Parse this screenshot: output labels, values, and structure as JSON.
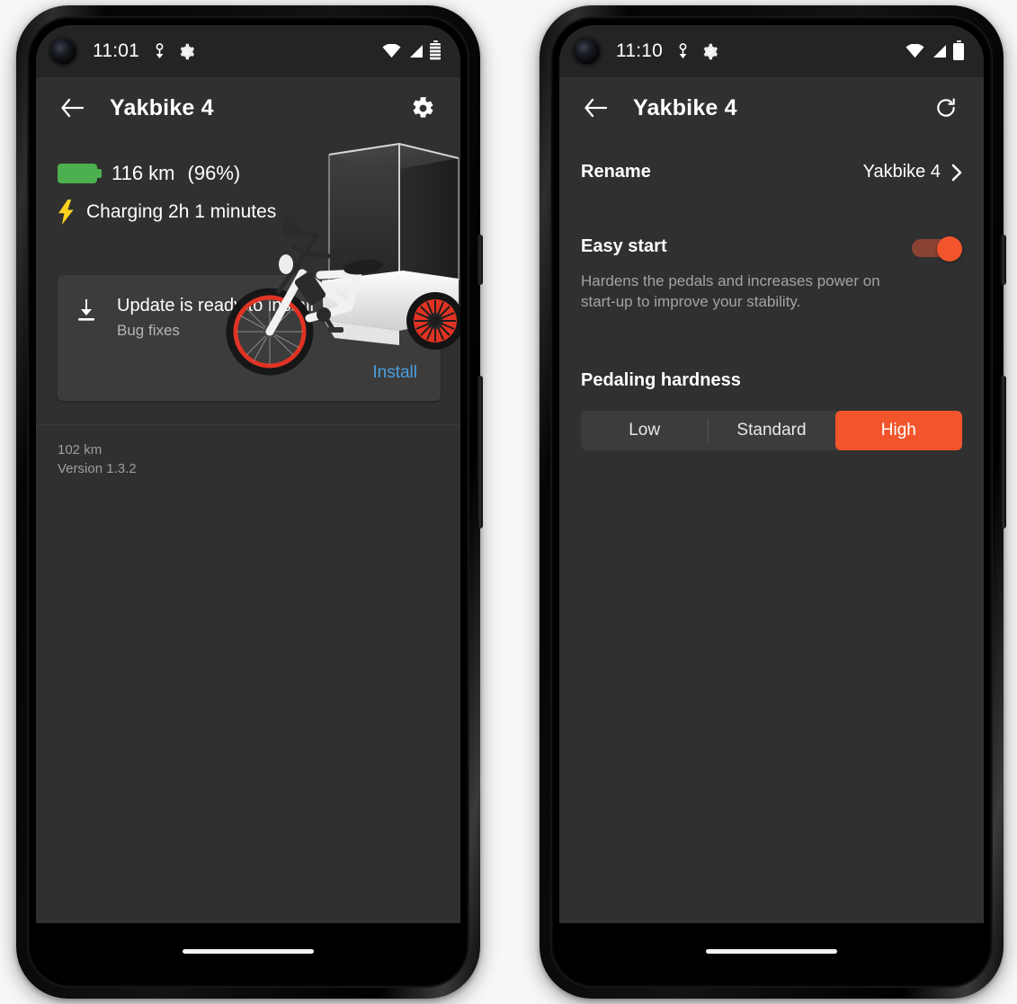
{
  "colors": {
    "accent_orange": "#f2552c",
    "link_blue": "#4a9fe0",
    "battery_green": "#4caf50",
    "screen_bg": "#303030",
    "card_bg": "#3c3c3c",
    "statusbar_bg": "#242424"
  },
  "left_phone": {
    "status_bar": {
      "time": "11:01",
      "icons": [
        "download-indicator-icon",
        "gear-icon",
        "wifi-icon",
        "cellular-signal-icon",
        "battery-striped-icon"
      ]
    },
    "app_bar": {
      "back_label": "←",
      "title": "Yakbike 4",
      "action_icon": "gear-icon"
    },
    "battery": {
      "range": "116 km",
      "percent": "(96%)",
      "charging_text": "Charging 2h 1 minutes",
      "charging_icon": "lightning-bolt-icon",
      "battery_icon": "battery-full-green-icon"
    },
    "bike_image_alt": "cargo-electric-bike-render",
    "update_card": {
      "icon": "download-icon",
      "title": "Update is ready to install",
      "subtitle": "Bug fixes",
      "action_label": "Install"
    },
    "footer": {
      "odometer": "102 km",
      "version": "Version 1.3.2"
    }
  },
  "right_phone": {
    "status_bar": {
      "time": "11:10",
      "icons": [
        "download-indicator-icon",
        "gear-icon",
        "wifi-icon",
        "cellular-signal-icon",
        "battery-full-icon"
      ]
    },
    "app_bar": {
      "back_label": "←",
      "title": "Yakbike 4",
      "action_icon": "refresh-icon"
    },
    "rename": {
      "label": "Rename",
      "value": "Yakbike 4",
      "chevron": "chevron-right-icon"
    },
    "easy_start": {
      "title": "Easy start",
      "description": "Hardens the pedals and increases power on start-up to improve your stability.",
      "toggle_state": "on"
    },
    "pedaling_hardness": {
      "title": "Pedaling hardness",
      "options": [
        "Low",
        "Standard",
        "High"
      ],
      "selected": "High"
    }
  }
}
